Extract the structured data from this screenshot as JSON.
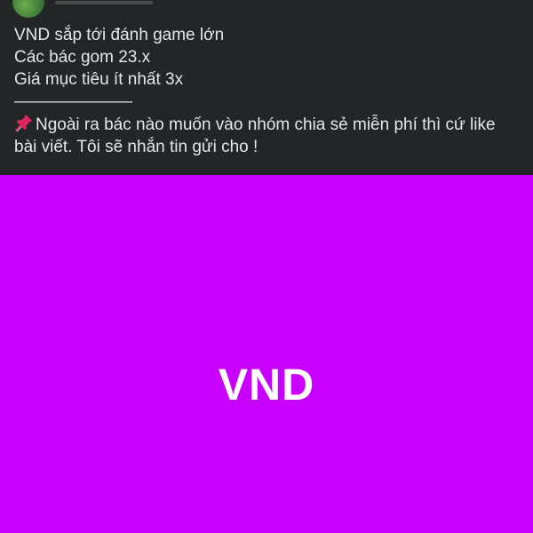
{
  "post": {
    "author_meta": "· ",
    "lines": [
      "VND sắp tới đánh game lớn",
      "Các bác gom 23.x",
      "Giá mục tiêu ít nhất 3x",
      "———————"
    ],
    "pin_icon": "pushpin-icon",
    "note": "Ngoài ra bác nào muốn vào nhóm chia sẻ miễn phí thì cứ like bài viết. Tôi sẽ nhắn tin gửi cho !"
  },
  "image": {
    "label": "VND",
    "background": "#c800ff"
  }
}
